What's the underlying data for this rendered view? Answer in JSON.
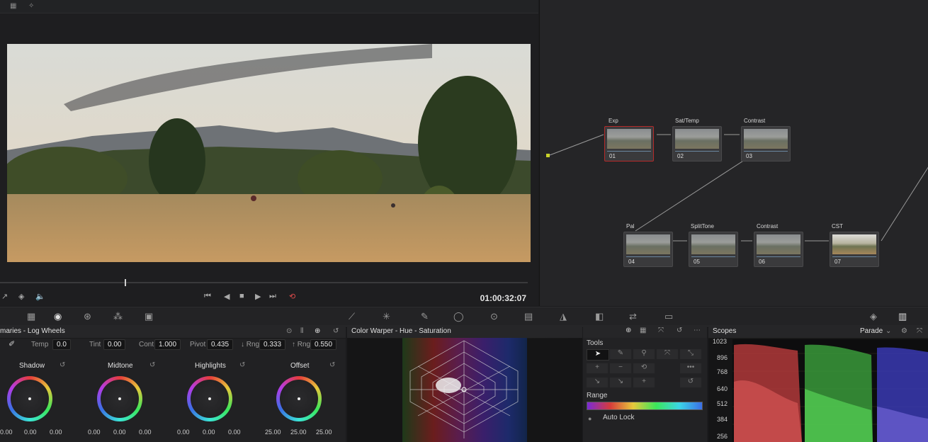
{
  "viewer": {
    "timecode": "01:00:32:07",
    "transport": [
      "⏮",
      "◀",
      "■",
      "▶",
      "⏭",
      "⟲"
    ]
  },
  "nodes": [
    {
      "label": "Exp",
      "num": "01"
    },
    {
      "label": "Sat/Temp",
      "num": "02"
    },
    {
      "label": "Contrast",
      "num": "03"
    },
    {
      "label": "Pal",
      "num": "04"
    },
    {
      "label": "SplitTone",
      "num": "05"
    },
    {
      "label": "Contrast",
      "num": "06"
    },
    {
      "label": "CST",
      "num": "07"
    }
  ],
  "wheels_panel": {
    "title": "maries - Log Wheels",
    "params": [
      {
        "label": "Temp",
        "value": "0.0"
      },
      {
        "label": "Tint",
        "value": "0.00"
      },
      {
        "label": "Cont",
        "value": "1.000"
      },
      {
        "label": "Pivot",
        "value": "0.435"
      },
      {
        "label": "↓ Rng",
        "value": "0.333"
      },
      {
        "label": "↑ Rng",
        "value": "0.550"
      }
    ],
    "wheels": [
      {
        "label": "Shadow",
        "values": [
          "0.00",
          "0.00",
          "0.00"
        ]
      },
      {
        "label": "Midtone",
        "values": [
          "0.00",
          "0.00",
          "0.00"
        ]
      },
      {
        "label": "Highlights",
        "values": [
          "0.00",
          "0.00",
          "0.00"
        ]
      },
      {
        "label": "Offset",
        "values": [
          "25.00",
          "25.00",
          "25.00"
        ]
      }
    ]
  },
  "warper": {
    "title": "Color Warper - Hue - Saturation"
  },
  "tools_panel": {
    "title": "Tools",
    "range_label": "Range",
    "auto_lock": "Auto Lock"
  },
  "scopes": {
    "title": "Scopes",
    "mode": "Parade",
    "scale": [
      "1023",
      "896",
      "768",
      "640",
      "512",
      "384",
      "256"
    ]
  }
}
